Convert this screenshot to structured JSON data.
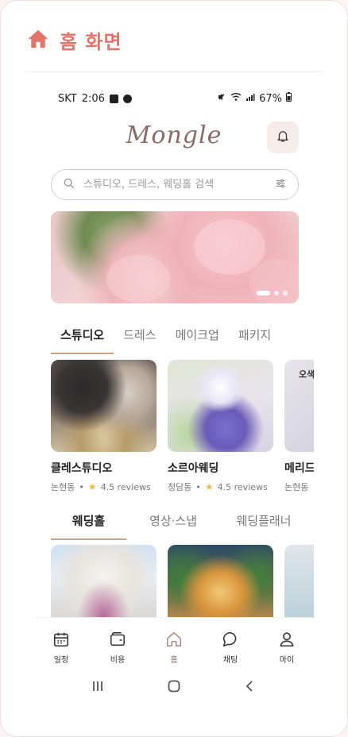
{
  "header": {
    "title": "홈 화면"
  },
  "statusbar": {
    "carrier": "SKT",
    "time": "2:06",
    "battery": "67%"
  },
  "app": {
    "logo": "Mongle"
  },
  "search": {
    "placeholder": "스튜디오, 드레스, 웨딩홀 검색"
  },
  "banner": {
    "slides": 3,
    "active_slide": 1
  },
  "tabs": [
    {
      "label": "스튜디오",
      "active": true
    },
    {
      "label": "드레스",
      "active": false
    },
    {
      "label": "메이크업",
      "active": false
    },
    {
      "label": "패키지",
      "active": false
    }
  ],
  "vendors": [
    {
      "name": "클레스튜디오",
      "area": "논현동",
      "rating": "4.5 reviews"
    },
    {
      "name": "소르아웨딩",
      "area": "청담동",
      "rating": "4.5 reviews"
    },
    {
      "name": "메리드",
      "area": "논현동",
      "rating": ""
    }
  ],
  "tabs2": [
    {
      "label": "웨딩홀",
      "active": true
    },
    {
      "label": "영상·스냅",
      "active": false
    },
    {
      "label": "웨딩플래너",
      "active": false
    }
  ],
  "bottom_nav": [
    {
      "label": "일정",
      "icon": "calendar-icon",
      "active": false
    },
    {
      "label": "비용",
      "icon": "wallet-icon",
      "active": false
    },
    {
      "label": "홈",
      "icon": "home-icon",
      "active": true
    },
    {
      "label": "채팅",
      "icon": "chat-icon",
      "active": false
    },
    {
      "label": "마이",
      "icon": "user-icon",
      "active": false
    }
  ],
  "colors": {
    "accent": "#e2746c",
    "brand": "#8a6b68",
    "tab_underline": "#c9a38a",
    "star": "#f0b84a"
  }
}
